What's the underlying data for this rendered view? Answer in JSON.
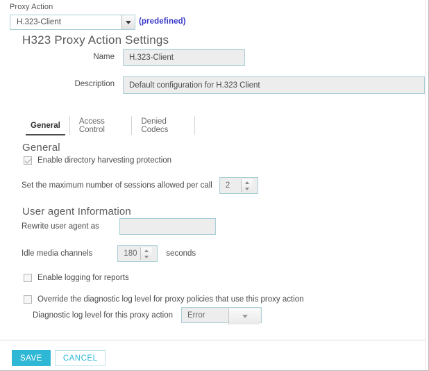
{
  "proxy_action": {
    "label": "Proxy Action",
    "selected": "H.323-Client",
    "predefined_note": "(predefined)"
  },
  "settings": {
    "title": "H323 Proxy Action Settings",
    "name_label": "Name",
    "name_value": "H.323-Client",
    "description_label": "Description",
    "description_value": "Default configuration for H.323 Client"
  },
  "tabs": [
    {
      "label": "General",
      "active": true
    },
    {
      "label": "Access Control",
      "active": false
    },
    {
      "label": "Denied Codecs",
      "active": false
    }
  ],
  "general": {
    "heading": "General",
    "harvest_checkbox_label": "Enable directory harvesting protection",
    "harvest_checked": true,
    "sessions_label": "Set the maximum number of sessions allowed per call",
    "sessions_value": "2"
  },
  "user_agent": {
    "heading": "User agent Information",
    "rewrite_label": "Rewrite user agent as",
    "rewrite_value": "",
    "idle_label": "Idle media channels",
    "idle_value": "180",
    "idle_units": "seconds"
  },
  "logging": {
    "enable_logging_label": "Enable logging for reports",
    "enable_logging_checked": false,
    "override_label": "Override the diagnostic log level for proxy policies that use this proxy action",
    "override_checked": false,
    "log_level_label": "Diagnostic log level for this proxy action",
    "log_level_value": "Error"
  },
  "footer": {
    "save_label": "SAVE",
    "cancel_label": "CANCEL"
  },
  "colors": {
    "accent": "#2fb7d6",
    "link": "#3737c9",
    "field_border": "#a9cfd6",
    "disabled_bg": "#ededed"
  }
}
